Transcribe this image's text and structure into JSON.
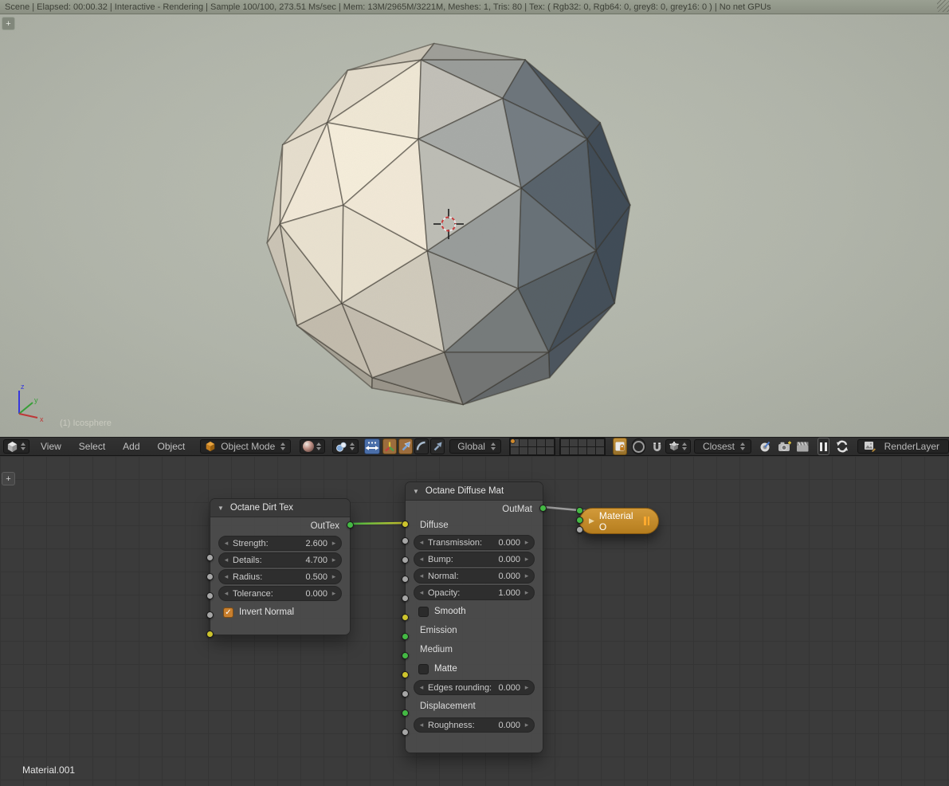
{
  "info_bar": {
    "status_text": "Scene | Elapsed: 00:00.32 | Interactive - Rendering | Sample 100/100, 273.51 Ms/sec | Mem: 13M/2965M/3221M, Meshes: 1, Tris: 80 | Tex: ( Rgb32: 0, Rgb64: 0, grey8: 0, grey16: 0 ) | No net GPUs"
  },
  "viewport": {
    "object_label": "(1) Icosphere",
    "axis_labels": {
      "x": "x",
      "y": "y",
      "z": "z"
    },
    "render": {
      "warm": "#eee6d4",
      "cool": "#5f7182",
      "background": "#b2b6ab"
    }
  },
  "header": {
    "menus": [
      {
        "label": "View"
      },
      {
        "label": "Select"
      },
      {
        "label": "Add"
      },
      {
        "label": "Object"
      }
    ],
    "mode_label": "Object Mode",
    "orientation_label": "Global",
    "snap_mode_label": "Closest",
    "render_layer_label": "RenderLayer",
    "icons": [
      "editor-type-cube",
      "object-mode-cube",
      "viewport-shading-sphere",
      "pivot-point",
      "manipulator-toggle",
      "translate-manipulator",
      "rotate-manipulator",
      "arc",
      "scale-manipulator",
      "layers-grid",
      "lock",
      "proportional-edit-circle",
      "snap-magnet",
      "snap-element-cube",
      "opengl-render",
      "render-image-camera",
      "render-anim-clapperboard",
      "pause",
      "refresh",
      "render-layer-image"
    ]
  },
  "node_editor": {
    "material_label": "Material.001",
    "nodes": {
      "dirt": {
        "title": "Octane Dirt Tex",
        "output_label": "OutTex",
        "sliders": [
          {
            "label": "Strength:",
            "value": "2.600"
          },
          {
            "label": "Details:",
            "value": "4.700"
          },
          {
            "label": "Radius:",
            "value": "0.500"
          },
          {
            "label": "Tolerance:",
            "value": "0.000"
          }
        ],
        "invert_normal": {
          "label": "Invert Normal",
          "checked": true
        }
      },
      "diffuse": {
        "title": "Octane Diffuse Mat",
        "output_label": "OutMat",
        "diffuse_label": "Diffuse",
        "transmission": {
          "label": "Transmission:",
          "value": "0.000"
        },
        "bump": {
          "label": "Bump:",
          "value": "0.000"
        },
        "normal": {
          "label": "Normal:",
          "value": "0.000"
        },
        "opacity": {
          "label": "Opacity:",
          "value": "1.000"
        },
        "smooth": {
          "label": "Smooth",
          "checked": false
        },
        "emission_label": "Emission",
        "medium_label": "Medium",
        "matte": {
          "label": "Matte",
          "checked": false
        },
        "edges_rounding": {
          "label": "Edges rounding:",
          "value": "0.000"
        },
        "displacement_label": "Displacement",
        "roughness": {
          "label": "Roughness:",
          "value": "0.000"
        }
      },
      "output": {
        "title": "Material O"
      }
    }
  },
  "colors": {
    "socket_green": "#44b944",
    "socket_yellow": "#cdc42d",
    "socket_gray": "#a6a6a6",
    "checkbox_orange": "#c87f2e",
    "accent_blue": "#4a6ea9",
    "manipulator_orange": "#9c6d3d",
    "output_node_orange": "#c08327",
    "wire_gray": "#9b9b9b"
  }
}
